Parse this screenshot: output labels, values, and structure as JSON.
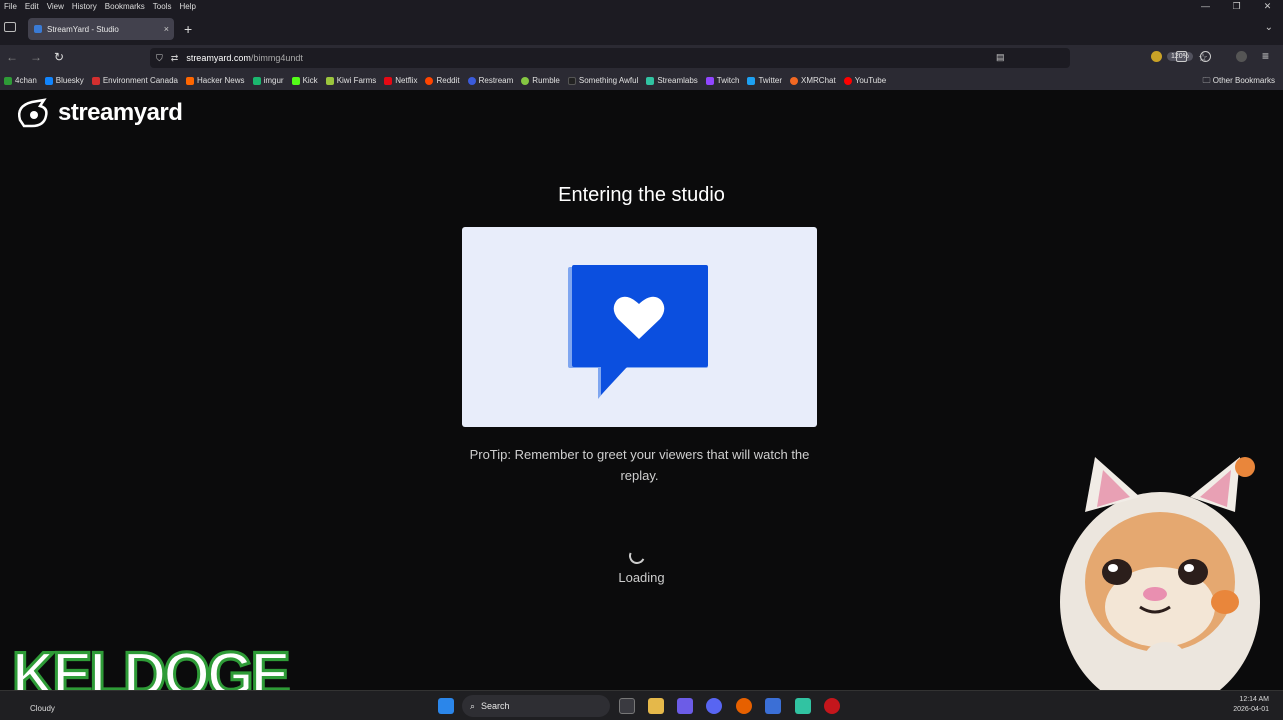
{
  "menubar": {
    "items": [
      "File",
      "Edit",
      "View",
      "History",
      "Bookmarks",
      "Tools",
      "Help"
    ]
  },
  "window_controls": {
    "minimize": "—",
    "restore": "❐",
    "close": "✕"
  },
  "tab": {
    "title": "StreamYard - Studio",
    "close": "×",
    "new_tab": "+"
  },
  "navbar": {
    "back": "←",
    "forward": "→",
    "reload": "↻",
    "url_domain": "streamyard.com",
    "url_path": "/bimmg4undt",
    "zoom": "120%"
  },
  "bookmarks": [
    {
      "label": "4chan",
      "color": "#2e9b37"
    },
    {
      "label": "Bluesky",
      "color": "#1185fe"
    },
    {
      "label": "Environment Canada",
      "color": "#d32f2f"
    },
    {
      "label": "Hacker News",
      "color": "#ff6600"
    },
    {
      "label": "imgur",
      "color": "#1bb76e"
    },
    {
      "label": "Kick",
      "color": "#53fc18"
    },
    {
      "label": "Kiwi Farms",
      "color": "#9bc53d"
    },
    {
      "label": "Netflix",
      "color": "#e50914"
    },
    {
      "label": "Reddit",
      "color": "#ff4500"
    },
    {
      "label": "Restream",
      "color": "#3b5bdb"
    },
    {
      "label": "Rumble",
      "color": "#85c742"
    },
    {
      "label": "Something Awful",
      "color": "#222222"
    },
    {
      "label": "Streamlabs",
      "color": "#31c3a2"
    },
    {
      "label": "Twitch",
      "color": "#9146ff"
    },
    {
      "label": "Twitter",
      "color": "#1da1f2"
    },
    {
      "label": "XMRChat",
      "color": "#f26822"
    },
    {
      "label": "YouTube",
      "color": "#ff0000"
    }
  ],
  "other_bookmarks": "Other Bookmarks",
  "app": {
    "logo_text": "streamyard"
  },
  "studio": {
    "heading": "Entering the studio",
    "protip": "ProTip: Remember to greet your viewers that will watch the replay.",
    "loading": "Loading"
  },
  "taskbar": {
    "weather": "Cloudy",
    "search_placeholder": "Search",
    "time": "12:14 AM",
    "date": "2026-04-01"
  },
  "overlay": {
    "keldoge": "KELDOGE"
  },
  "colors": {
    "brand_blue": "#0b4fdf",
    "card_bg": "#e8edfa",
    "page_bg": "#0b0b0c"
  }
}
